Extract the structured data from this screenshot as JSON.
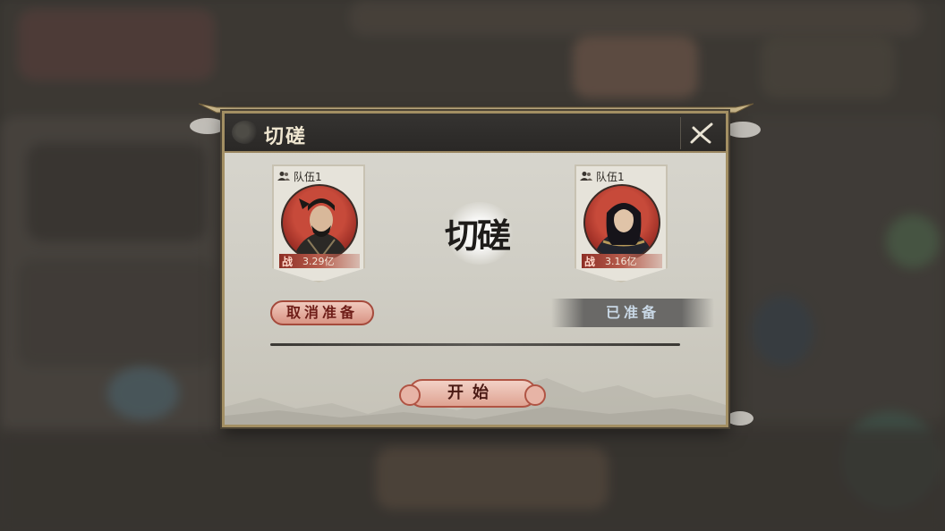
{
  "dialog": {
    "title": "切磋",
    "center_title": "切磋"
  },
  "teams": [
    {
      "label": "队伍1",
      "power_icon": "战",
      "power": "3.29亿",
      "status_button": "取消准备"
    },
    {
      "label": "队伍1",
      "power_icon": "战",
      "power": "3.16亿",
      "status_text": "已准备"
    }
  ],
  "actions": {
    "start": "开始"
  },
  "colors": {
    "panel_border": "#a38f63",
    "title_bar": "#2a2826",
    "accent_red": "#b05444",
    "ready_text": "#c9d8e6"
  }
}
